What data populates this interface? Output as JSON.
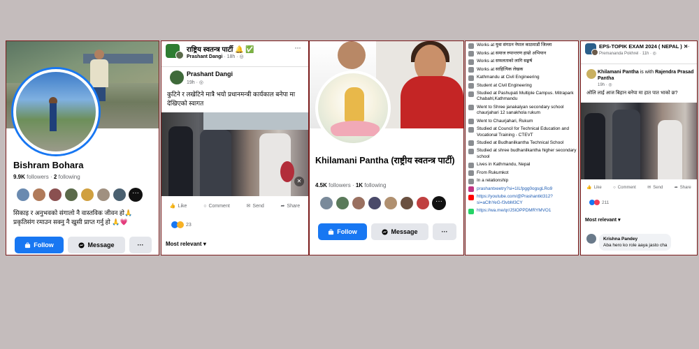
{
  "panel1": {
    "name": "Bishram Bohara",
    "followers_count": "9.9K",
    "followers_label": "followers",
    "following_count": "2",
    "following_label": "following",
    "bio_line1": "सिकाइ र अनुभवको संगालो नै वास्तविक जीवन हो🙏",
    "bio_line2": "प्रकृतिसंग रमाउन सक्नु नै खुसी प्राप्त गर्नु हो 🙏💗",
    "follow_label": "Follow",
    "message_label": "Message",
    "more_label": "···",
    "friends_more": "···"
  },
  "panel2": {
    "page_title": "राष्ट्रिय स्वतन्त्र पार्टी 🔔 ✅",
    "shared_by": "Prashant Dangi",
    "shared_time": "18h",
    "inner_name": "Prashant Dangi",
    "inner_time": "19h",
    "post_text": "कुटिने र लखेटिने मात्रै भयो प्रधानमन्त्री कार्यकाल बनेपा मा देखिएको स्वागत",
    "like_label": "Like",
    "comment_label": "Comment",
    "send_label": "Send",
    "share_label": "Share",
    "reaction_count": "23",
    "sort_label": "Most relevant",
    "menu": "···"
  },
  "panel3": {
    "name": "Khilamani Pantha (राष्ट्रीय स्वतन्त्र पार्टी)",
    "followers_count": "4.5K",
    "followers_label": "followers",
    "following_count": "1K",
    "following_label": "following",
    "follow_label": "Follow",
    "message_label": "Message",
    "more_label": "···",
    "friends_more": "···"
  },
  "panel4": {
    "rows": [
      {
        "text": "Works at युवा संगठन नेपाल काठमाडौं जिल्ला"
      },
      {
        "text": "Works at समाज रुपान्तरण हाम्रो अभियान"
      },
      {
        "text": "Works at सफलताको लागि सङ्घर्ष"
      },
      {
        "text": "Works at साहित्यिक लेखक"
      },
      {
        "text": "Kathmandu at Civil Engineering"
      },
      {
        "text": "Student at Civil Engineering"
      },
      {
        "text": "Studied at Pashupati Multiple Campus. Mitrapark Chabahl,Kathmandu"
      },
      {
        "text": "Went to Shree janakalyan secondary school chaurjahari 12 sanakhola rukum"
      },
      {
        "text": "Went to Chaurjahari, Rukum"
      },
      {
        "text": "Studied at Council for Technical Education and Vocational Training - CTEVT"
      },
      {
        "text": "Studied at Budhanilkantha Technical School"
      },
      {
        "text": "Studied at shree budhanilkantha higher secondary school"
      },
      {
        "text": "Lives in Kathmandu, Nepal"
      },
      {
        "text": "From Rukumkot"
      },
      {
        "text": "In a relationship"
      },
      {
        "text": "prashantxeetry?si=1ILfpgg0ogsgLRo9",
        "link": true
      },
      {
        "text": "https://youtube.com/@Prashantkt312?si=aClhYeG-f3vbM3CY",
        "link": true
      },
      {
        "text": "https://wa.me/qr/JSlOPPDMRYMVO1",
        "link": true
      }
    ]
  },
  "panel5": {
    "group_title": "EPS-TOPIK EXAM 2024 ( NEPAL ) ✕",
    "shared_by": "Premananda Pokhrel",
    "shared_time": "11h",
    "inner_name": "Khilamani Pantha",
    "inner_with": "is with",
    "inner_with_name": "Rajendra Prasad Pantha",
    "inner_time": "19h",
    "post_text": "ओलि लाई आज बिहान बनेपा मा हात पात भाको छ?",
    "like_label": "Like",
    "comment_label": "Comment",
    "send_label": "Send",
    "share_label": "Share",
    "reaction_count": "211",
    "sort_label": "Most relevant",
    "comment_author": "Krishna Pandey",
    "comment_text": "Aba hero ko role aaya jasto cha",
    "menu": "···"
  },
  "colors": {
    "background": "#c4bcbc",
    "facebook_blue": "#1877f2",
    "panel_border": "#7a1a1a"
  }
}
